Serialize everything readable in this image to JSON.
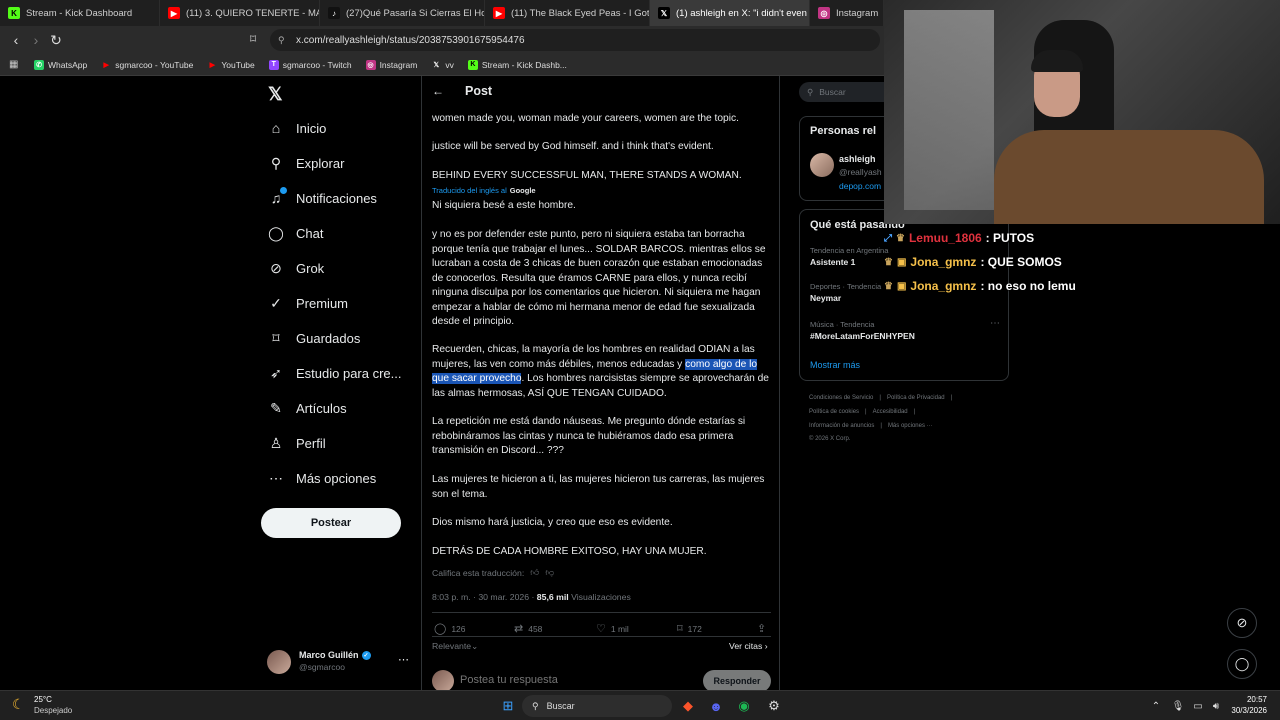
{
  "browser": {
    "tabs": [
      {
        "label": "Stream - Kick Dashboard",
        "icon": "kick-icon"
      },
      {
        "label": "(11) 3. QUIERO TENERTE - MANU W/",
        "icon": "youtube-icon"
      },
      {
        "label": "(27)Qué Pasaría Si Cierras El Hocico",
        "icon": "tiktok-icon"
      },
      {
        "label": "(11) The Black Eyed Peas - I Gotta Fe",
        "icon": "youtube-icon"
      },
      {
        "label": "(1) ashleigh en X: \"i didn't even k",
        "icon": "x-icon"
      },
      {
        "label": "Instagram",
        "icon": "instagram-icon"
      }
    ],
    "url": "x.com/reallyashleigh/status/2038753901675954476",
    "bookmarks": [
      {
        "label": "WhatsApp",
        "icon": "whatsapp-icon"
      },
      {
        "label": "sgmarcoo - YouTube",
        "icon": "youtube-icon"
      },
      {
        "label": "YouTube",
        "icon": "youtube-icon"
      },
      {
        "label": "sgmarcoo - Twitch",
        "icon": "twitch-icon"
      },
      {
        "label": "Instagram",
        "icon": "instagram-icon"
      },
      {
        "label": "vv",
        "icon": "x-icon"
      },
      {
        "label": "Stream - Kick Dashb...",
        "icon": "kick-icon"
      }
    ]
  },
  "sidebar": {
    "items": [
      {
        "label": "Inicio",
        "icon": "home-icon"
      },
      {
        "label": "Explorar",
        "icon": "search-icon"
      },
      {
        "label": "Notificaciones",
        "icon": "bell-icon"
      },
      {
        "label": "Chat",
        "icon": "chat-icon"
      },
      {
        "label": "Grok",
        "icon": "grok-icon"
      },
      {
        "label": "Premium",
        "icon": "premium-icon"
      },
      {
        "label": "Guardados",
        "icon": "bookmark-icon"
      },
      {
        "label": "Estudio para cre...",
        "icon": "rocket-icon"
      },
      {
        "label": "Artículos",
        "icon": "article-icon"
      },
      {
        "label": "Perfil",
        "icon": "person-icon"
      },
      {
        "label": "Más opciones",
        "icon": "more-icon"
      }
    ],
    "post_button": "Postear",
    "account": {
      "name": "Marco Guillén",
      "handle": "@sgmarcoo"
    }
  },
  "post": {
    "header": "Post",
    "original_lines": [
      "women made you, woman made your careers, women are the topic.",
      "justice will be served by God himself. and i think that's evident.",
      "BEHIND EVERY SUCCESSFUL MAN, THERE STANDS A WOMAN."
    ],
    "translated_by": "Traducido del inglés al",
    "translator": "Google",
    "translated": {
      "p1": "Ni siquiera besé a este hombre.",
      "p2": "y no es por defender este punto, pero ni siquiera estaba tan borracha porque tenía que trabajar el lunes... SOLDAR BARCOS. mientras ellos se lucraban a costa de 3 chicas de buen corazón que estaban emocionadas de conocerlos. Resulta que éramos CARNE para ellos, y nunca recibí ninguna disculpa por los comentarios que hicieron. Ni siquiera me hagan empezar a hablar de cómo mi hermana menor de edad fue sexualizada desde el principio.",
      "p3_before": "Recuerden, chicas, la mayoría de los hombres en realidad ODIAN a las mujeres, las ven como más débiles, menos educadas y ",
      "p3_selected": "como algo de lo que sacar provecho",
      "p3_after": ". Los hombres narcisistas siempre se aprovecharán de las almas hermosas, ASÍ QUE TENGAN CUIDADO.",
      "p4": "La repetición me está dando náuseas. Me pregunto dónde estarías si rebobináramos las cintas y nunca te hubiéramos dado esa primera transmisión en Discord... ???",
      "p5": "Las mujeres te hicieron a ti, las mujeres hicieron tus carreras, las mujeres son el tema.",
      "p6": "Dios mismo hará justicia, y creo que eso es evidente.",
      "p7": "DETRÁS DE CADA HOMBRE EXITOSO, HAY UNA MUJER."
    },
    "rate_translation": "Califica esta traducción:",
    "timestamp": "8:03 p. m. · 30 mar. 2026 · ",
    "views_count": "85,6 mil",
    "views_label": "Visualizaciones",
    "stats": {
      "replies": "126",
      "reposts": "458",
      "likes": "1 mil",
      "bookmarks": "172"
    },
    "sort_label": "Relevante",
    "quotes_label": "Ver citas",
    "reply_placeholder": "Postea tu respuesta",
    "reply_button": "Responder"
  },
  "right": {
    "search_placeholder": "Buscar",
    "people_title": "Personas rel",
    "person": {
      "name": "ashleigh",
      "handle": "@reallyash",
      "link": "depop.com"
    },
    "trending_title": "Qué está pasando",
    "trends": [
      {
        "context": "Tendencia en Argentina",
        "name": "Asistente 1"
      },
      {
        "context": "Deportes · Tendencia",
        "name": "Neymar"
      },
      {
        "context": "Música · Tendencia",
        "name": "#MoreLatamForENHYPEN"
      }
    ],
    "show_more": "Mostrar más",
    "footer": [
      [
        "Condiciones de Servicio",
        "Política de Privacidad"
      ],
      [
        "Política de cookies",
        "Accesibilidad"
      ],
      [
        "Información de anuncios",
        "Más opciones ···"
      ],
      [
        "© 2026 X Corp."
      ]
    ]
  },
  "stream_chat": [
    {
      "user": "Lemuu_1806",
      "message": ": PUTOS",
      "color": "#e0323e"
    },
    {
      "user": "Jona_gmnz",
      "message": ": QUE SOMOS",
      "color": "#f5c04a"
    },
    {
      "user": "Jona_gmnz",
      "message": ": no eso no lemu",
      "color": "#f5c04a"
    }
  ],
  "taskbar": {
    "weather_temp": "25°C",
    "weather_desc": "Despejado",
    "search": "Buscar",
    "time": "20:57",
    "date": "30/3/2026"
  },
  "colors": {
    "accent": "#1d9bf0",
    "selection": "#1a55b5",
    "background": "#000000"
  }
}
